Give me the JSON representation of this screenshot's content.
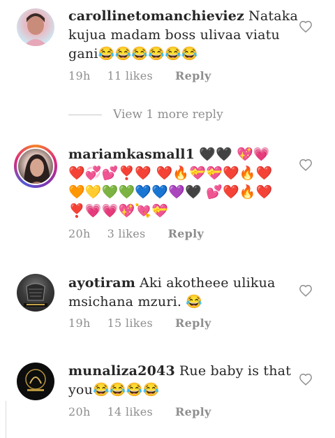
{
  "comments": [
    {
      "username": "carollinetomanchieviez",
      "text": "Nataka kujua madam boss ulivaa viatu gani😂😂😂😂😂😂",
      "time": "19h",
      "likes": "11 likes",
      "reply": "Reply"
    },
    {
      "username": "mariamkasmall1",
      "text": "🖤🖤 💖💗❤️💞💕❣️❤️ ❤️🔥💝💝❤️🔥❤️🧡💛💚💚💙💙💜🖤 💕❤️🔥❤️ ❣️💗💗💖💘💝",
      "time": "20h",
      "likes": "3 likes",
      "reply": "Reply"
    },
    {
      "username": "ayotiram",
      "text": "Aki akotheee ulikua msichana mzuri. 😂",
      "time": "19h",
      "likes": "15 likes",
      "reply": "Reply"
    },
    {
      "username": "munaliza2043",
      "text": "Rue baby is that you😂😂😂😂",
      "time": "20h",
      "likes": "14 likes",
      "reply": "Reply"
    }
  ],
  "view_more": "View 1 more reply",
  "icons": {
    "like": "heart-outline-icon"
  },
  "colors": {
    "text": "#262626",
    "muted": "#8e8e8e",
    "background": "#ffffff"
  }
}
